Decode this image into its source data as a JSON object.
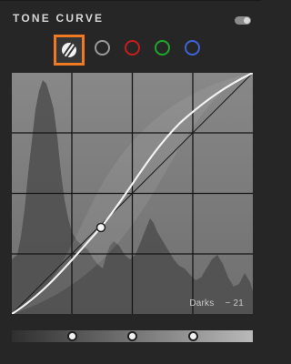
{
  "panel": {
    "title": "TONE CURVE",
    "toggle_icon": "panel-toggle-icon"
  },
  "channels": [
    {
      "name": "rgb-curve-icon",
      "color": "#f07a22",
      "selected": true
    },
    {
      "name": "luminance",
      "color": "#9a9a9a",
      "selected": false
    },
    {
      "name": "red",
      "color": "#c61d1d",
      "selected": false
    },
    {
      "name": "green",
      "color": "#20a62a",
      "selected": false
    },
    {
      "name": "blue",
      "color": "#3f64d8",
      "selected": false
    }
  ],
  "curve": {
    "readout_region": "Darks",
    "readout_value": "− 21",
    "grid_divisions": 4,
    "colors": {
      "curve": "#f2f2f2",
      "histogram": "#595959",
      "background": "#7d7d7d",
      "grid": "#151515"
    }
  },
  "region_slider": {
    "splits": [
      0.25,
      0.5,
      0.75
    ],
    "gradient": [
      "#2f2f2f",
      "#b9b9b9"
    ]
  }
}
